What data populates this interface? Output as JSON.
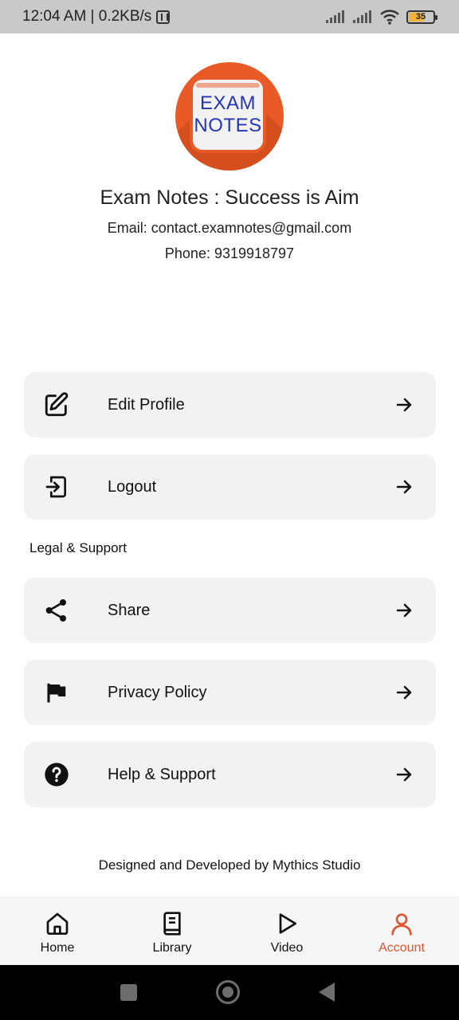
{
  "status_bar": {
    "time_speed": "12:04 AM | 0.2KB/s",
    "battery_level": "35"
  },
  "profile": {
    "logo_line1": "EXAM",
    "logo_line2": "NOTES",
    "name": "Exam Notes : Success is Aim",
    "email": "Email: contact.examnotes@gmail.com",
    "phone": "Phone: 9319918797"
  },
  "account_menu": [
    {
      "label": "Edit Profile",
      "icon": "edit-icon"
    },
    {
      "label": "Logout",
      "icon": "logout-icon"
    }
  ],
  "legal_section": {
    "title": "Legal & Support",
    "items": [
      {
        "label": "Share",
        "icon": "share-icon"
      },
      {
        "label": "Privacy Policy",
        "icon": "flag-icon"
      },
      {
        "label": "Help & Support",
        "icon": "help-icon"
      }
    ]
  },
  "footer": {
    "credit": "Designed and Developed by Mythics Studio"
  },
  "tabs": [
    {
      "label": "Home",
      "icon": "home-icon",
      "active": false
    },
    {
      "label": "Library",
      "icon": "book-icon",
      "active": false
    },
    {
      "label": "Video",
      "icon": "play-icon",
      "active": false
    },
    {
      "label": "Account",
      "icon": "user-icon",
      "active": true
    }
  ],
  "colors": {
    "accent": "#e0542e",
    "card_bg": "#f2f2f2",
    "logo_orange": "#e95a26",
    "logo_text_blue": "#2435b8"
  }
}
